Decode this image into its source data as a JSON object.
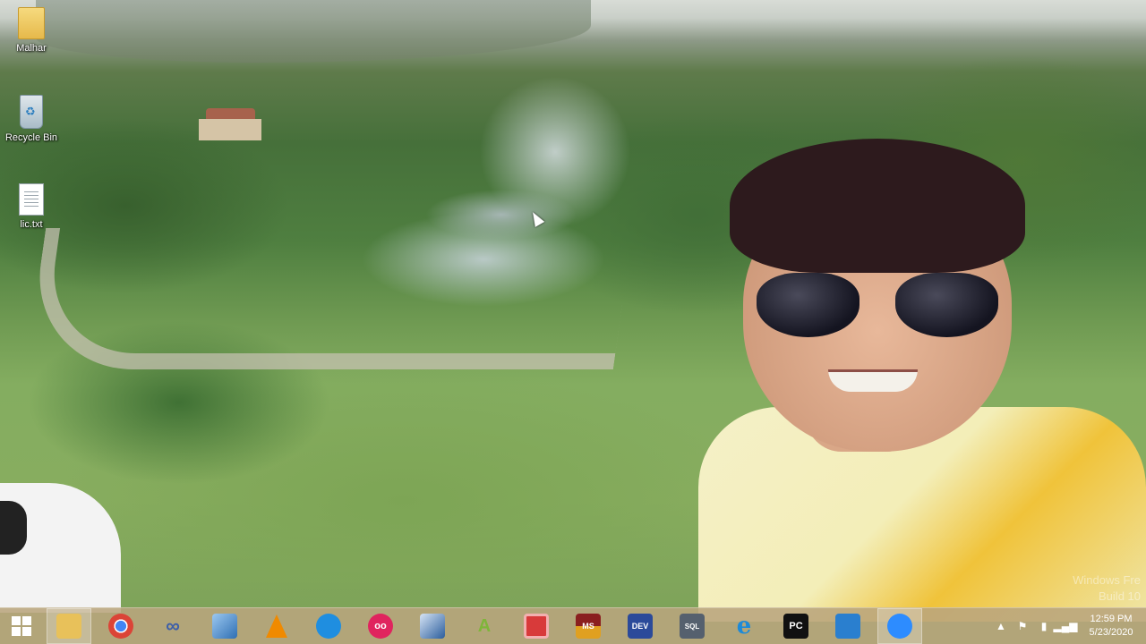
{
  "desktop": {
    "icons": [
      {
        "label": "Malhar",
        "icon": "folder-icon"
      },
      {
        "label": "Recycle Bin",
        "icon": "recycle-bin-icon"
      },
      {
        "label": "lic.txt",
        "icon": "text-file-icon"
      }
    ],
    "watermark": {
      "line1": "Windows Fre",
      "line2": "Build 10"
    }
  },
  "taskbar": {
    "apps": [
      {
        "icon": "file-explorer-icon",
        "text": "",
        "color": "#e8c15a"
      },
      {
        "icon": "chrome-icon",
        "text": "",
        "color": "#db4437"
      },
      {
        "icon": "infinity-icon",
        "text": "∞",
        "color": "#3d5fa8"
      },
      {
        "icon": "virtualbox-icon",
        "text": "",
        "color": "#2f6fb3"
      },
      {
        "icon": "vlc-icon",
        "text": "",
        "color": "#f08a00"
      },
      {
        "icon": "sync-icon",
        "text": "",
        "color": "#1f8ee0"
      },
      {
        "icon": "oo-icon",
        "text": "oo",
        "color": "#e0245e"
      },
      {
        "icon": "cube-icon",
        "text": "",
        "color": "#2a5d9c"
      },
      {
        "icon": "a-logo-icon",
        "text": "A",
        "color": "#7fb53a"
      },
      {
        "icon": "red-screen-icon",
        "text": "",
        "color": "#d83a3a"
      },
      {
        "icon": "ms-c-icon",
        "text": "MS",
        "color": "#8a1f1f"
      },
      {
        "icon": "dev-icon",
        "text": "DEV",
        "color": "#2b4a9a"
      },
      {
        "icon": "sql-icon",
        "text": "SQL",
        "color": "#55606e"
      },
      {
        "icon": "internet-explorer-icon",
        "text": "e",
        "color": "#1d8ad8"
      },
      {
        "icon": "pycharm-icon",
        "text": "PC",
        "color": "#111111"
      },
      {
        "icon": "lock-icon",
        "text": "",
        "color": "#2a7fcf"
      },
      {
        "icon": "zoom-icon",
        "text": "",
        "color": "#2d8cff"
      }
    ],
    "tray": {
      "icons": [
        "chevron-up-icon",
        "flag-icon",
        "battery-icon",
        "signal-icon"
      ],
      "time": "12:59 PM",
      "date": "5/23/2020"
    }
  }
}
